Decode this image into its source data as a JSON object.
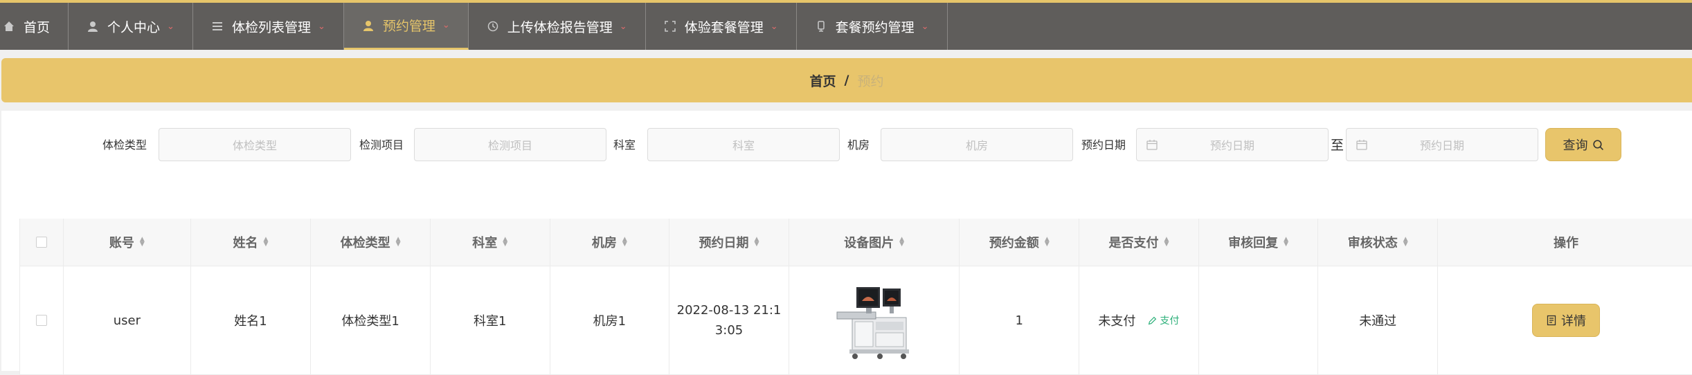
{
  "nav": {
    "items": [
      {
        "label": "首页",
        "icon": "home-icon"
      },
      {
        "label": "个人中心",
        "icon": "user-icon"
      },
      {
        "label": "体检列表管理",
        "icon": "list-icon"
      },
      {
        "label": "预约管理",
        "icon": "user-icon",
        "active": true
      },
      {
        "label": "上传体检报告管理",
        "icon": "clock-icon"
      },
      {
        "label": "体验套餐管理",
        "icon": "fullscreen-icon"
      },
      {
        "label": "套餐预约管理",
        "icon": "phone-icon"
      }
    ],
    "caret": "⌄"
  },
  "breadcrumb": {
    "home": "首页",
    "separator": "/",
    "current": "预约"
  },
  "search": {
    "type_label": "体检类型",
    "type_placeholder": "体检类型",
    "item_label": "检测项目",
    "item_placeholder": "检测项目",
    "dept_label": "科室",
    "dept_placeholder": "科室",
    "room_label": "机房",
    "room_placeholder": "机房",
    "date_label": "预约日期",
    "date_start_placeholder": "预约日期",
    "to_label": "至",
    "date_end_placeholder": "预约日期",
    "query_label": "查询"
  },
  "table": {
    "headers": [
      "账号",
      "姓名",
      "体检类型",
      "科室",
      "机房",
      "预约日期",
      "设备图片",
      "预约金额",
      "是否支付",
      "审核回复",
      "审核状态",
      "操作"
    ],
    "rows": [
      {
        "account": "user",
        "name": "姓名1",
        "type": "体检类型1",
        "dept": "科室1",
        "room": "机房1",
        "date_line1": "2022-08-13 21:1",
        "date_line2": "3:05",
        "amount": "1",
        "paid": "未支付",
        "pay_action": "支付",
        "reply": "",
        "status": "未通过",
        "detail_label": "详情"
      }
    ]
  },
  "colors": {
    "accent": "#e8c56b",
    "nav_bg": "#5f5d5b",
    "pay_green": "#2db07a"
  }
}
